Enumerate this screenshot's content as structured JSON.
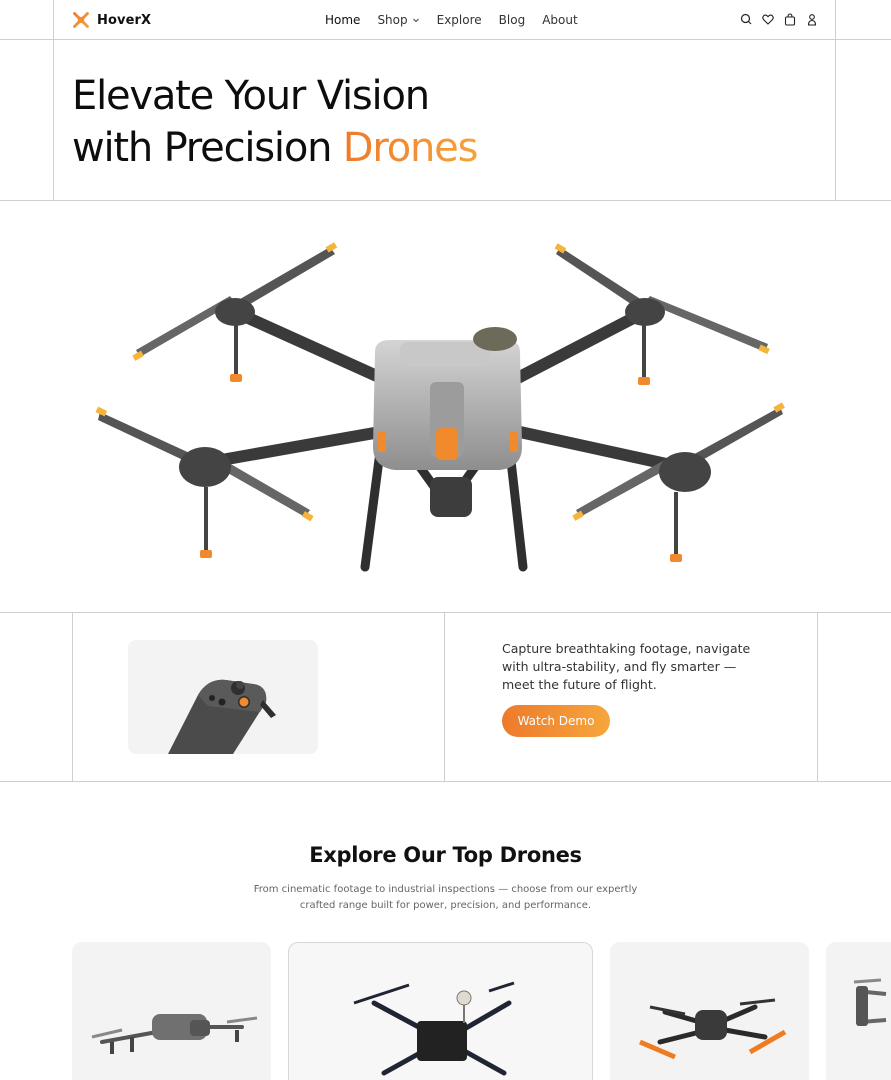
{
  "brand": {
    "name": "HoverX",
    "accent": "#f0832f"
  },
  "nav": {
    "items": [
      {
        "label": "Home"
      },
      {
        "label": "Shop"
      },
      {
        "label": "Explore"
      },
      {
        "label": "Blog"
      },
      {
        "label": "About"
      }
    ]
  },
  "header_icons": [
    "search-icon",
    "heart-icon",
    "bag-icon",
    "user-icon"
  ],
  "hero": {
    "title_line1": "Elevate Your Vision",
    "title_line2_prefix": "with Precision ",
    "title_line2_accent": "Drones"
  },
  "promo": {
    "tagline": "Capture breathtaking footage, navigate with ultra-stability, and fly smarter — meet the future of flight.",
    "cta_label": "Watch Demo"
  },
  "explore": {
    "title": "Explore Our Top Drones",
    "subtitle": "From cinematic footage to industrial inspections — choose from our expertly crafted range built for power, precision, and performance."
  }
}
